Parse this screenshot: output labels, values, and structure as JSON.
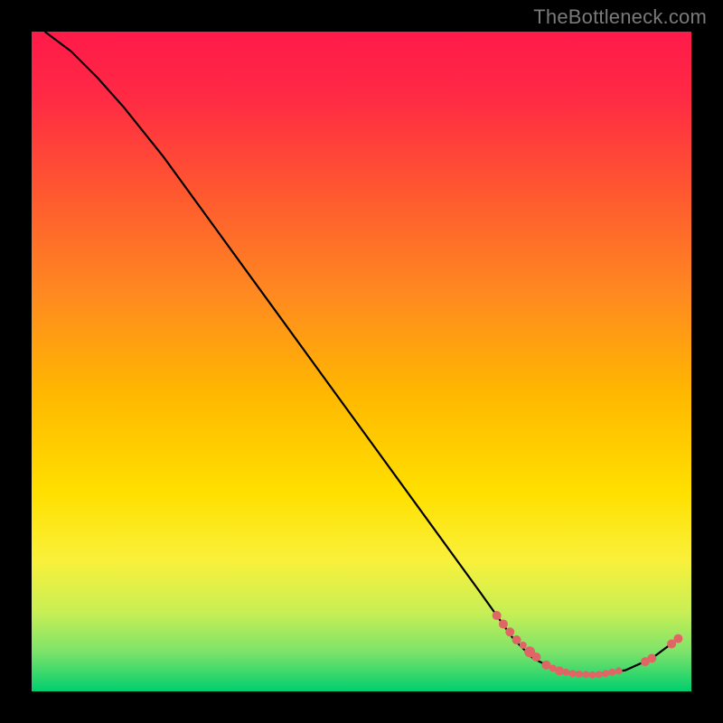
{
  "watermark": "TheBottleneck.com",
  "chart_data": {
    "type": "line",
    "title": "",
    "xlabel": "",
    "ylabel": "",
    "xlim": [
      0,
      100
    ],
    "ylim": [
      0,
      100
    ],
    "background_gradient": {
      "top": "#ff1744",
      "upper": "#ff6a2a",
      "middle": "#ffd400",
      "lower": "#d8f25a",
      "bottom": "#00d26a"
    },
    "curve": [
      {
        "x": 2,
        "y": 100
      },
      {
        "x": 6,
        "y": 97
      },
      {
        "x": 10,
        "y": 93
      },
      {
        "x": 14,
        "y": 88.5
      },
      {
        "x": 20,
        "y": 81
      },
      {
        "x": 28,
        "y": 70
      },
      {
        "x": 36,
        "y": 59
      },
      {
        "x": 44,
        "y": 48
      },
      {
        "x": 52,
        "y": 37
      },
      {
        "x": 60,
        "y": 26
      },
      {
        "x": 68,
        "y": 15
      },
      {
        "x": 73,
        "y": 8
      },
      {
        "x": 76,
        "y": 5
      },
      {
        "x": 80,
        "y": 3
      },
      {
        "x": 85,
        "y": 2.5
      },
      {
        "x": 90,
        "y": 3.2
      },
      {
        "x": 94,
        "y": 5
      },
      {
        "x": 98,
        "y": 8
      }
    ],
    "markers": [
      {
        "x": 70.5,
        "y": 11.5,
        "r": 5
      },
      {
        "x": 71.5,
        "y": 10.2,
        "r": 5
      },
      {
        "x": 72.5,
        "y": 9.0,
        "r": 5
      },
      {
        "x": 73.5,
        "y": 7.8,
        "r": 5
      },
      {
        "x": 74.5,
        "y": 7.0,
        "r": 4
      },
      {
        "x": 75.5,
        "y": 6.0,
        "r": 6
      },
      {
        "x": 76.5,
        "y": 5.2,
        "r": 5
      },
      {
        "x": 78.0,
        "y": 4.0,
        "r": 5
      },
      {
        "x": 79.0,
        "y": 3.5,
        "r": 4
      },
      {
        "x": 80.0,
        "y": 3.1,
        "r": 5
      },
      {
        "x": 81.0,
        "y": 2.9,
        "r": 4
      },
      {
        "x": 82.0,
        "y": 2.7,
        "r": 4
      },
      {
        "x": 83.0,
        "y": 2.6,
        "r": 4
      },
      {
        "x": 84.0,
        "y": 2.55,
        "r": 4
      },
      {
        "x": 85.0,
        "y": 2.5,
        "r": 4
      },
      {
        "x": 86.0,
        "y": 2.55,
        "r": 4
      },
      {
        "x": 87.0,
        "y": 2.7,
        "r": 4
      },
      {
        "x": 88.0,
        "y": 2.9,
        "r": 4
      },
      {
        "x": 89.0,
        "y": 3.1,
        "r": 4
      },
      {
        "x": 93.0,
        "y": 4.5,
        "r": 5
      },
      {
        "x": 94.0,
        "y": 5.0,
        "r": 5
      },
      {
        "x": 97.0,
        "y": 7.2,
        "r": 5
      },
      {
        "x": 98.0,
        "y": 8.0,
        "r": 5
      }
    ],
    "marker_color": "#e06666",
    "curve_color": "#000000"
  }
}
